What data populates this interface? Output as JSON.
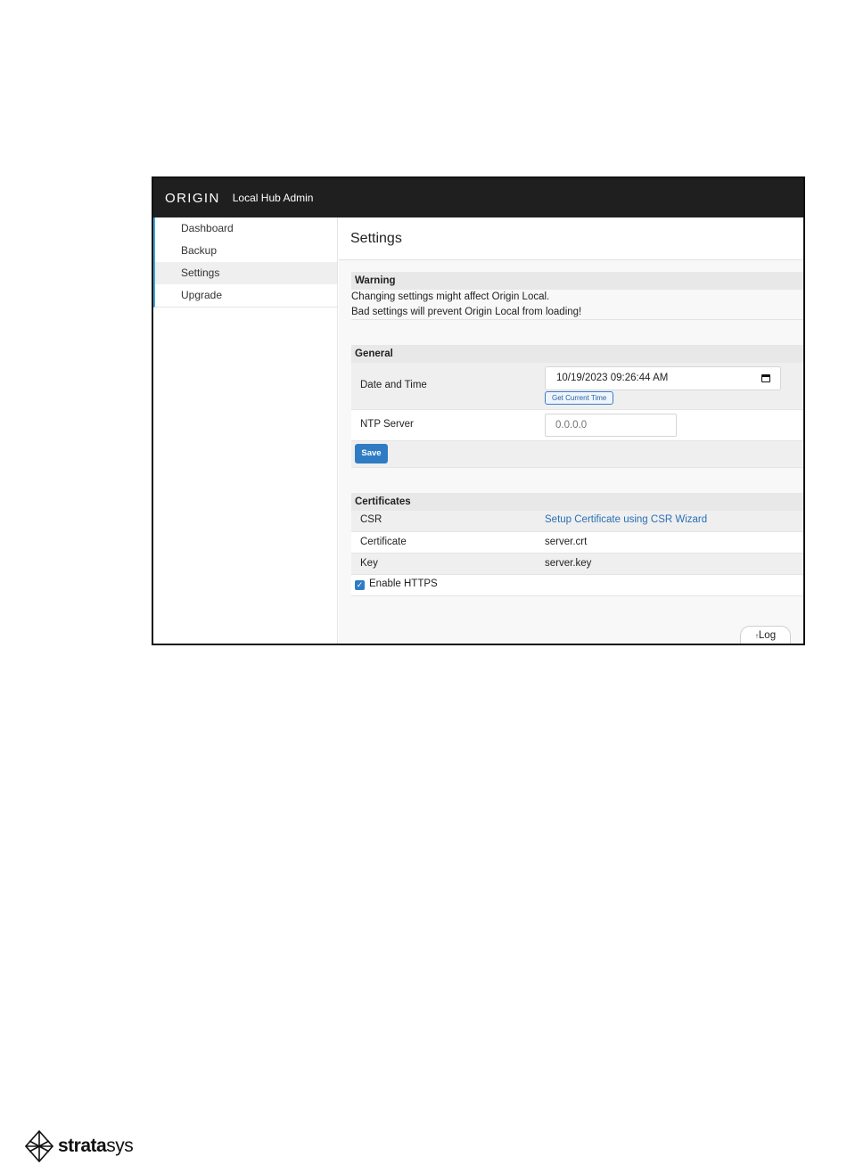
{
  "header": {
    "brand": "ORIGIN",
    "app_name": "Local Hub Admin"
  },
  "sidebar": {
    "items": [
      {
        "label": "Dashboard"
      },
      {
        "label": "Backup"
      },
      {
        "label": "Settings",
        "active": true
      },
      {
        "label": "Upgrade"
      }
    ]
  },
  "page": {
    "title": "Settings"
  },
  "warning": {
    "heading": "Warning",
    "line1": "Changing settings might affect Origin Local.",
    "line2": "Bad settings will prevent Origin Local from loading!"
  },
  "general": {
    "heading": "General",
    "date_label": "Date and Time",
    "date_value": "10/19/2023 09:26:44 AM",
    "get_time_label": "Get Current Time",
    "ntp_label": "NTP Server",
    "ntp_placeholder": "0.0.0.0",
    "save_label": "Save"
  },
  "certificates": {
    "heading": "Certificates",
    "csr_label": "CSR",
    "csr_link": "Setup Certificate using CSR Wizard",
    "certificate_label": "Certificate",
    "certificate_value": "server.crt",
    "key_label": "Key",
    "key_value": "server.key",
    "https_label": "Enable HTTPS",
    "https_checked": true
  },
  "log_button": {
    "label": "Log"
  },
  "footer": {
    "logo_bold": "strata",
    "logo_light": "sys"
  },
  "icons": {
    "calendar": "calendar-icon",
    "checkbox": "checkmark-icon",
    "log": "arrow-up-icon",
    "logo": "stratasys-logo-icon"
  },
  "colors": {
    "topbar": "#1f1f1f",
    "accent": "#2f7cc4",
    "link": "#2a6fb5",
    "nav_indicator": "#3fa7d6"
  }
}
